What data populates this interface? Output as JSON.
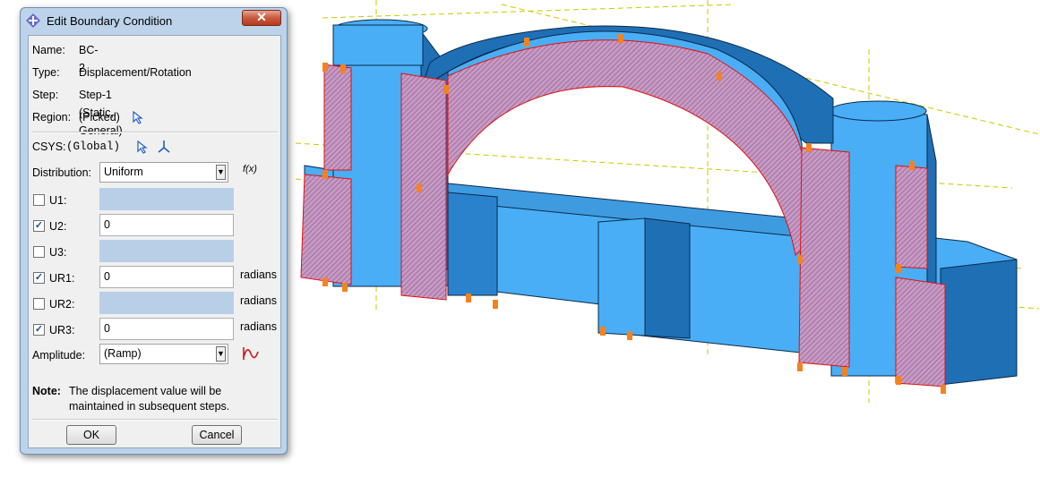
{
  "dialog": {
    "title": "Edit Boundary Condition",
    "close_symbol": "✕",
    "name_label": "Name:",
    "name_value": "BC-2",
    "type_label": "Type:",
    "type_value": "Displacement/Rotation",
    "step_label": "Step:",
    "step_value": "Step-1 (Static, General)",
    "region_label": "Region:",
    "region_value": "(Picked)",
    "csys_label": "CSYS:",
    "csys_value": "(Global)",
    "distribution_label": "Distribution:",
    "distribution_value": "Uniform",
    "fx_label": "f(x)",
    "dofs": [
      {
        "label": "U1:",
        "checked": false,
        "value": "",
        "unit": ""
      },
      {
        "label": "U2:",
        "checked": true,
        "value": "0",
        "unit": ""
      },
      {
        "label": "U3:",
        "checked": false,
        "value": "",
        "unit": ""
      },
      {
        "label": "UR1:",
        "checked": true,
        "value": "0",
        "unit": "radians"
      },
      {
        "label": "UR2:",
        "checked": false,
        "value": "",
        "unit": "radians"
      },
      {
        "label": "UR3:",
        "checked": true,
        "value": "0",
        "unit": "radians"
      }
    ],
    "amplitude_label": "Amplitude:",
    "amplitude_value": "(Ramp)",
    "note_label": "Note:",
    "note_line1": "The displacement value will be",
    "note_line2": "maintained in subsequent steps.",
    "ok_label": "OK",
    "cancel_label": "Cancel"
  },
  "viewport": {
    "model_color": "#49aef5",
    "shadow_color": "#1f6fb5",
    "region_color": "#b884b0",
    "constraint_color": "#f58220",
    "datum_color": "#c8c800"
  }
}
